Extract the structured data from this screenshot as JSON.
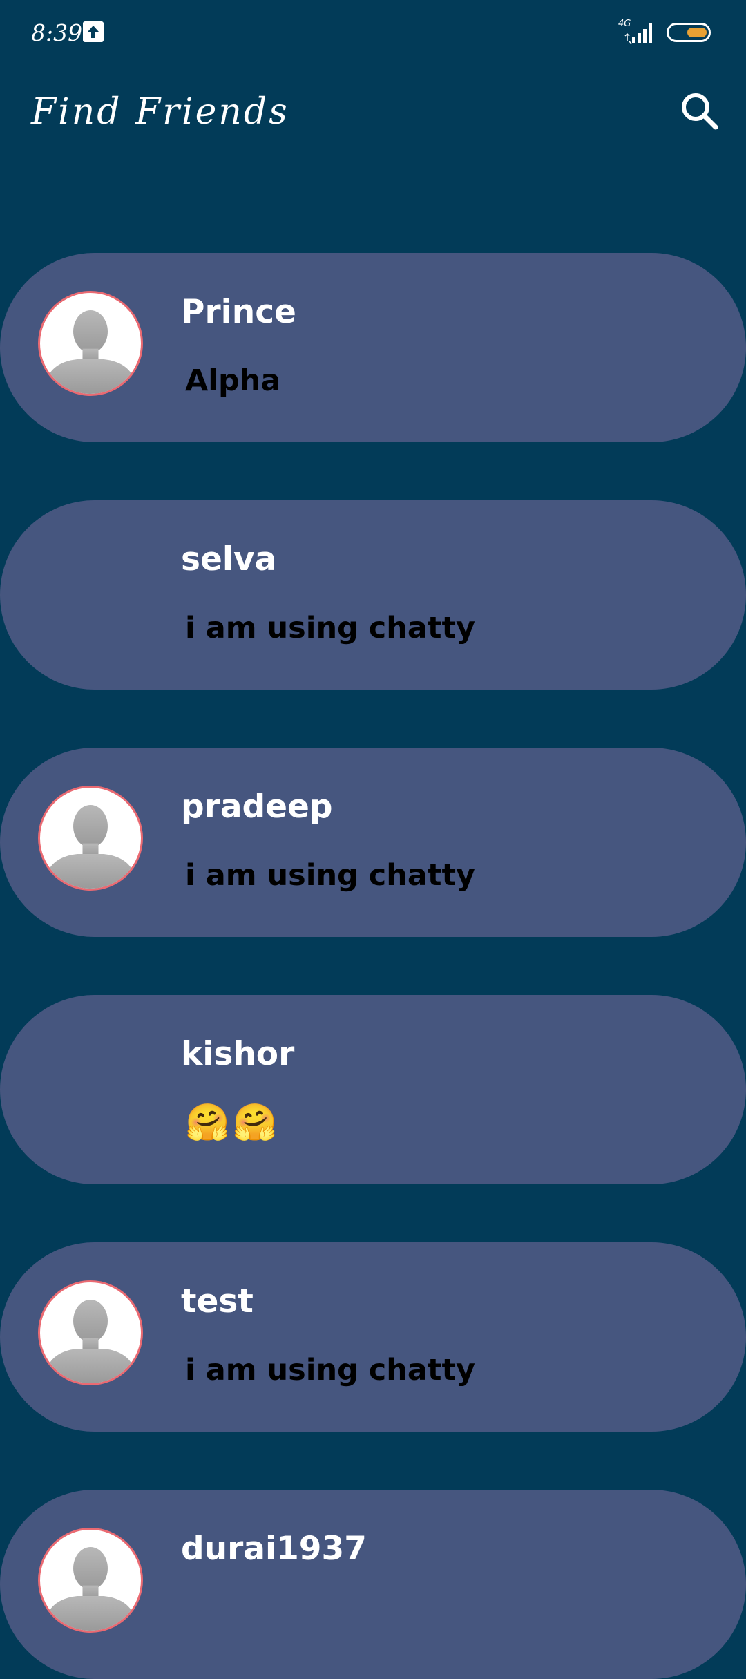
{
  "status_bar": {
    "time": "8:39",
    "network": "4G",
    "colors": {
      "battery_fill": "#e7a034"
    }
  },
  "header": {
    "title": "Find Friends",
    "search_icon": "search-icon"
  },
  "colors": {
    "background": "#023b58",
    "card": "#46567f",
    "avatar_ring": "#ea6a72"
  },
  "friends": [
    {
      "name": "Prince",
      "status": "Alpha",
      "has_avatar": true
    },
    {
      "name": "selva",
      "status": "i am using chatty",
      "has_avatar": false
    },
    {
      "name": "pradeep",
      "status": "i am using chatty",
      "has_avatar": true
    },
    {
      "name": "kishor",
      "status": "🤗🤗",
      "has_avatar": false
    },
    {
      "name": "test",
      "status": "i am using chatty",
      "has_avatar": true
    },
    {
      "name": "durai1937",
      "status": "",
      "has_avatar": true
    }
  ]
}
